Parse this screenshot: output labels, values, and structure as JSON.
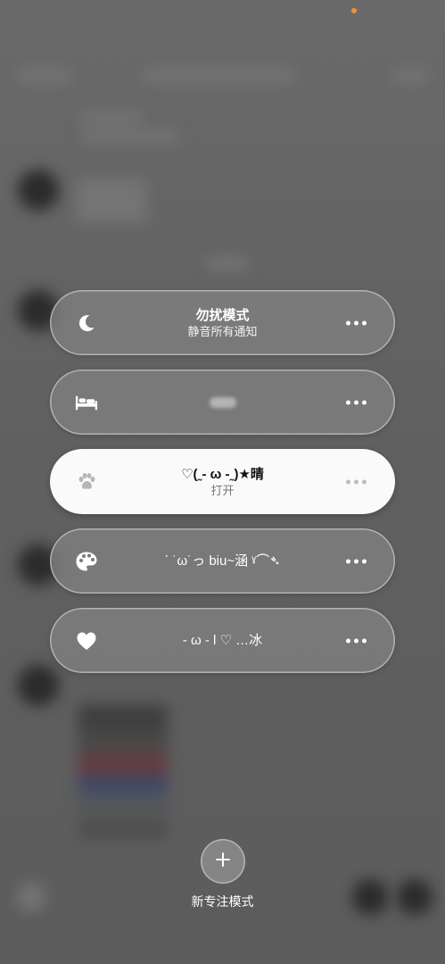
{
  "status_bar": {
    "indicator_color": "#f0932b"
  },
  "focus_modes": [
    {
      "icon": "moon-icon",
      "title": "勿扰模式",
      "subtitle": "静音所有通知",
      "more": "more-icon",
      "active": false
    },
    {
      "icon": "bed-icon",
      "title": "",
      "subtitle": "",
      "more": "more-icon",
      "active": false
    },
    {
      "icon": "paw-icon",
      "title": "♡(˷‑ ω ‑˷)★晴",
      "subtitle": "打开",
      "more": "more-icon",
      "active": true
    },
    {
      "icon": "palette-icon",
      "title": "ˊ ˙ω˙っ biu~涵 ˠ⌒➴",
      "subtitle": "",
      "more": "more-icon",
      "active": false
    },
    {
      "icon": "heart-icon",
      "title": "- ω - l ♡ …冰",
      "subtitle": "",
      "more": "more-icon",
      "active": false
    }
  ],
  "new_focus": {
    "icon": "plus-icon",
    "label": "新专注模式"
  },
  "colors": {
    "pill_active": "#fafafa",
    "pill_inactive": "#808080",
    "backdrop": "#5f5f5f"
  }
}
